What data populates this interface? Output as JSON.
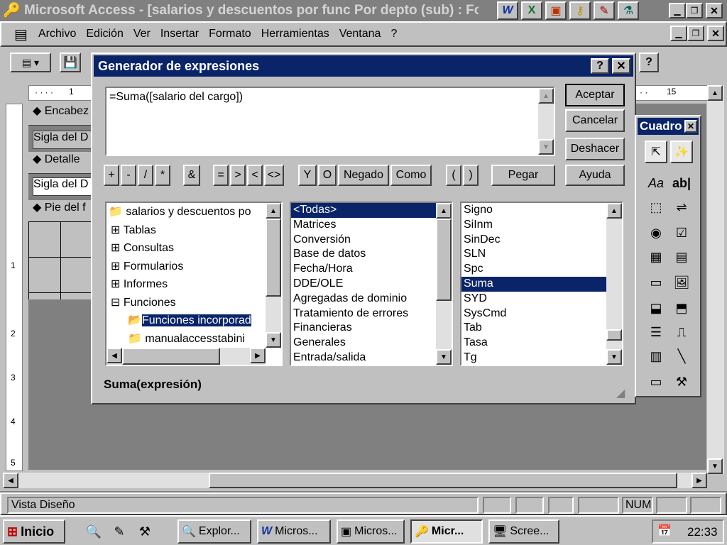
{
  "window": {
    "title": "Microsoft Access - [salarios y descuentos por func Por depto (sub) : Fo"
  },
  "menu": [
    "Archivo",
    "Edición",
    "Ver",
    "Insertar",
    "Formato",
    "Herramientas",
    "Ventana",
    "?"
  ],
  "form": {
    "sections": [
      "Encabez",
      "Detalle",
      "Pie del f"
    ],
    "fields": [
      "Sigla del D",
      "Sigla del D"
    ],
    "ruler_marks": [
      "1",
      "2",
      "3",
      "4",
      "5"
    ],
    "ruler_top": [
      "1",
      "15"
    ]
  },
  "dialog": {
    "title": "Generador de expresiones",
    "expression": "=Suma([salario del cargo])",
    "buttons": {
      "ok": "Aceptar",
      "cancel": "Cancelar",
      "undo": "Deshacer",
      "paste": "Pegar",
      "help": "Ayuda"
    },
    "operators": [
      "+",
      "-",
      "/",
      "*",
      "&",
      "=",
      ">",
      "<",
      "<>",
      "Y",
      "O",
      "Negado",
      "Como",
      "(",
      ")"
    ],
    "tree": [
      {
        "label": "salarios y descuentos po",
        "type": "folder"
      },
      {
        "label": "Tablas",
        "type": "plus"
      },
      {
        "label": "Consultas",
        "type": "plus"
      },
      {
        "label": "Formularios",
        "type": "plus"
      },
      {
        "label": "Informes",
        "type": "plus"
      },
      {
        "label": "Funciones",
        "type": "minus"
      },
      {
        "label": "Funciones incorporad",
        "type": "open-folder"
      },
      {
        "label": "manualaccesstabini",
        "type": "folder"
      }
    ],
    "categories": [
      "<Todas>",
      "Matrices",
      "Conversión",
      "Base de datos",
      "Fecha/Hora",
      "DDE/OLE",
      "Agregadas de dominio",
      "Tratamiento de errores",
      "Financieras",
      "Generales",
      "Entrada/salida"
    ],
    "functions": [
      "Signo",
      "SiInm",
      "SinDec",
      "SLN",
      "Spc",
      "Suma",
      "SYD",
      "SysCmd",
      "Tab",
      "Tasa",
      "Tg"
    ],
    "selected_category": "<Todas>",
    "selected_function": "Suma",
    "syntax": "Suma(expresión)"
  },
  "toolbox": {
    "title": "Cuadro"
  },
  "status": {
    "text": "Vista Diseño",
    "num": "NUM"
  },
  "taskbar": {
    "start": "Inicio",
    "tasks": [
      "Explor...",
      "Micros...",
      "Micros...",
      "Micr...",
      "Scree..."
    ],
    "time": "22:33"
  }
}
